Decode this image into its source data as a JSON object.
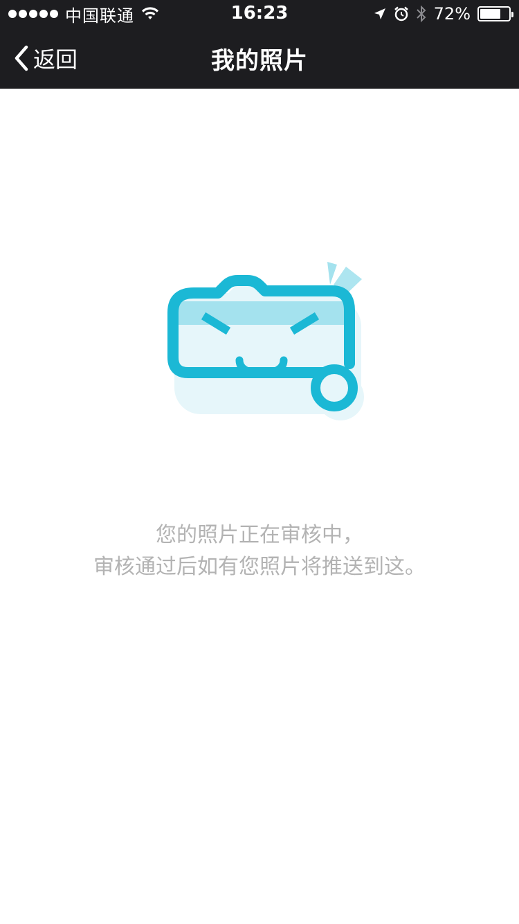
{
  "status_bar": {
    "carrier": "中国联通",
    "time": "16:23",
    "battery_percent": "72%",
    "battery_level": 0.72,
    "icons": [
      "signal-dots-icon",
      "wifi-icon",
      "location-arrow-icon",
      "alarm-icon",
      "bluetooth-icon",
      "battery-icon"
    ]
  },
  "nav": {
    "back_label": "返回",
    "title": "我的照片"
  },
  "empty_state": {
    "illustration": "camera-face-icon",
    "line1": "您的照片正在审核中，",
    "line2": "审核通过后如有您照片将推送到这。"
  },
  "colors": {
    "topbar": "#1d1d20",
    "accent": "#1bb8d5",
    "accent_light": "#a4e2ee",
    "accent_pale": "#e6f6fa",
    "message_text": "#b3b3b3"
  }
}
